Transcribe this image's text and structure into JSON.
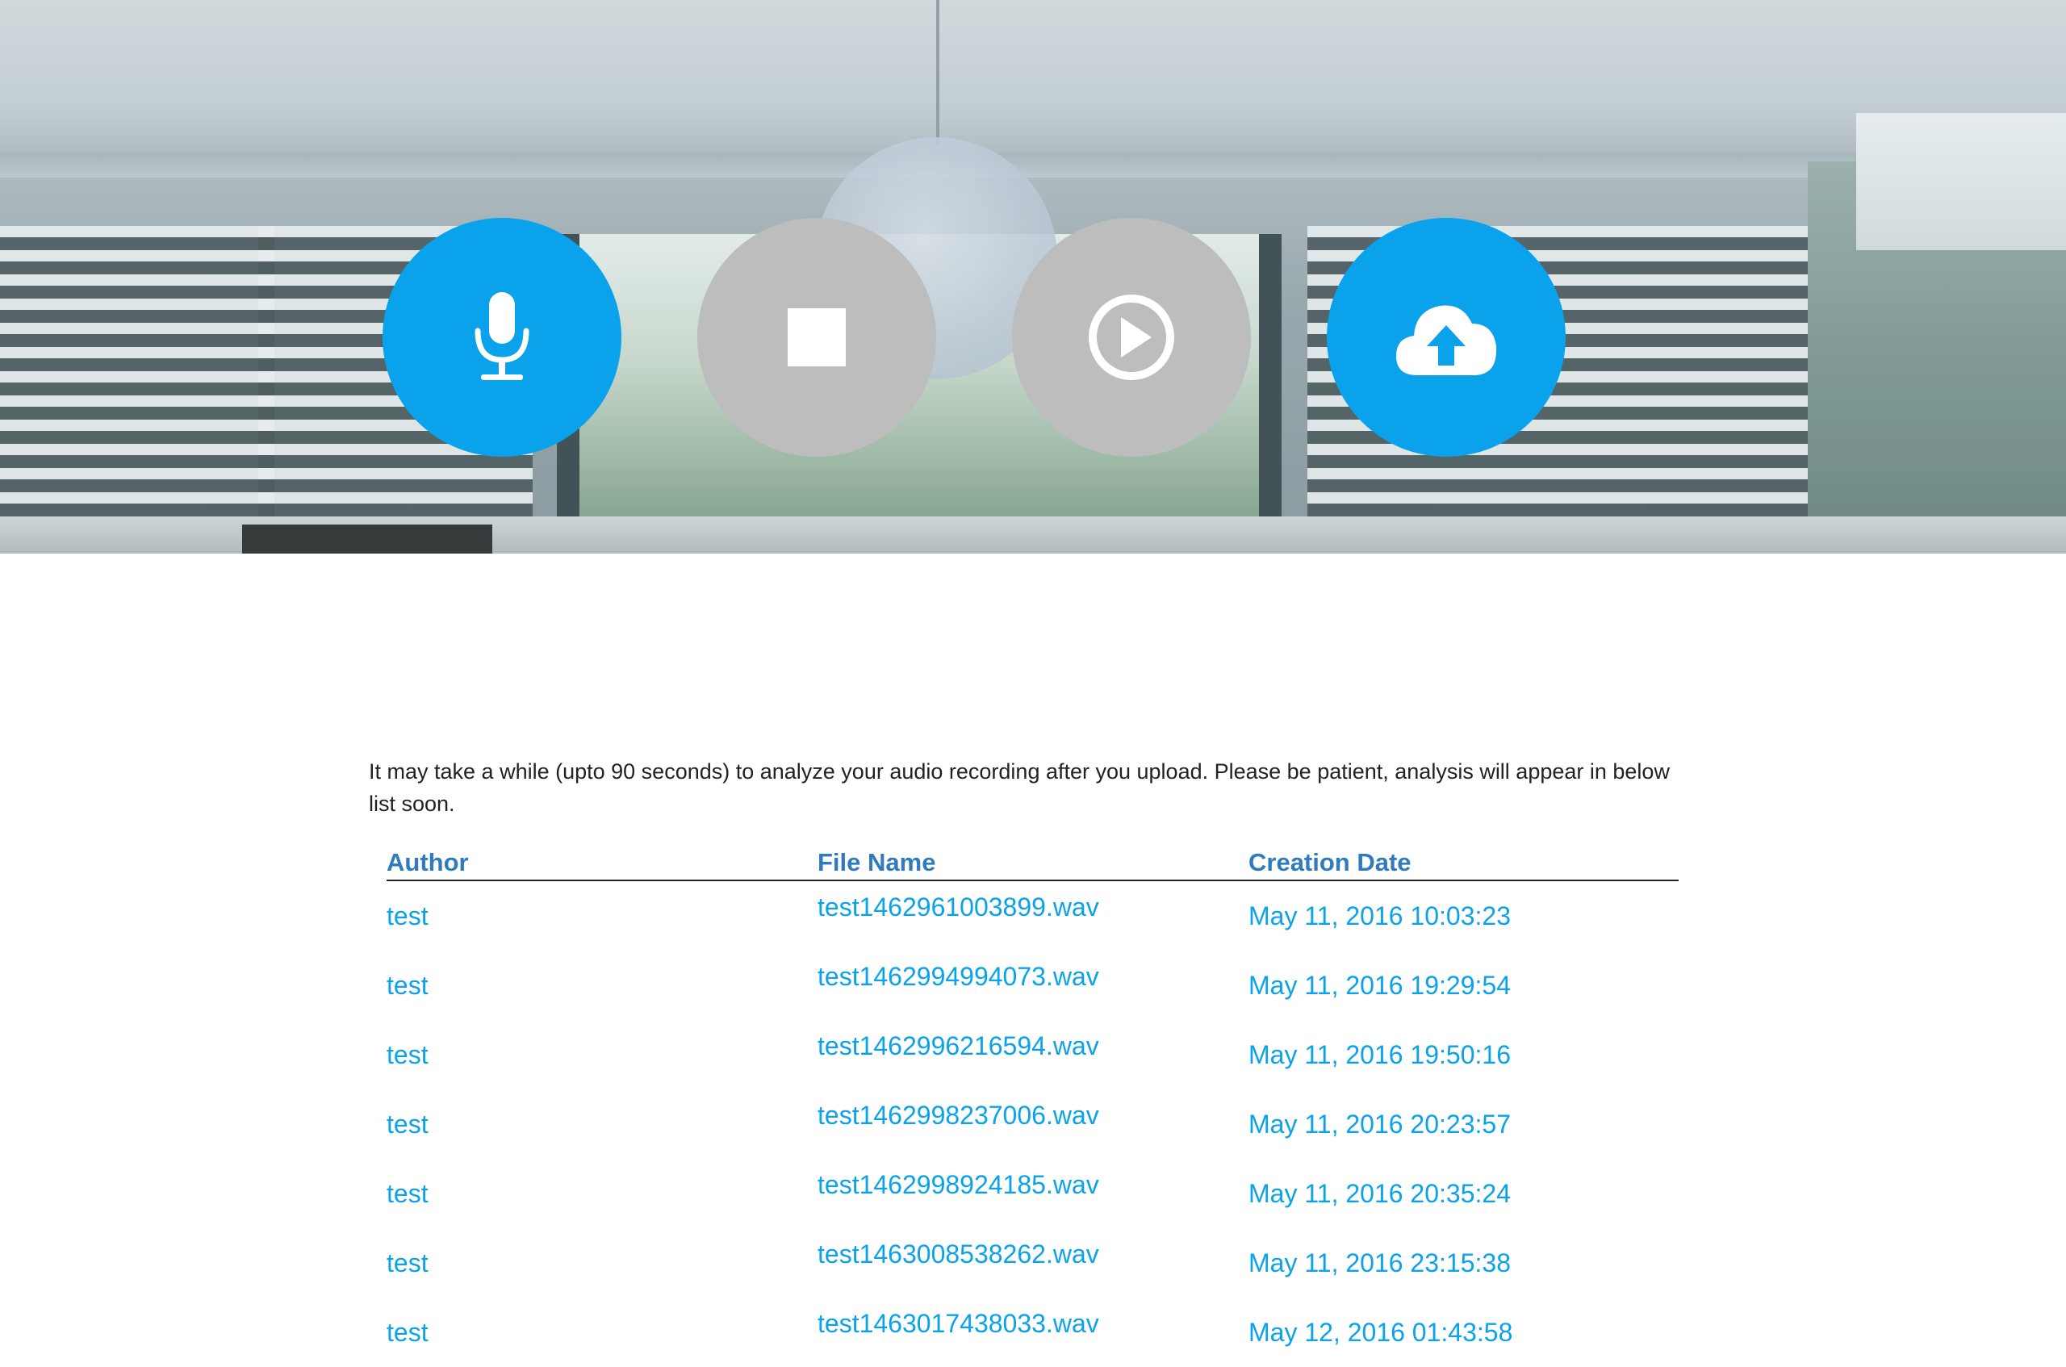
{
  "controls": {
    "record": {
      "icon": "microphone-icon",
      "state": "active",
      "color": "#0aa2ea"
    },
    "stop": {
      "icon": "stop-icon",
      "state": "disabled",
      "color": "#bdbdbd"
    },
    "play": {
      "icon": "play-circle-icon",
      "state": "disabled",
      "color": "#bdbdbd"
    },
    "upload": {
      "icon": "cloud-upload-icon",
      "state": "active",
      "color": "#0aa2ea"
    }
  },
  "notice": "It may take a while (upto 90 seconds) to analyze your audio recording after you upload. Please be patient, analysis will appear in below list soon.",
  "table": {
    "headers": {
      "author": "Author",
      "file_name": "File Name",
      "creation_date": "Creation Date"
    },
    "rows": [
      {
        "author": "test",
        "file_name": "test1462961003899.wav",
        "creation_date": "May 11, 2016 10:03:23"
      },
      {
        "author": "test",
        "file_name": "test1462994994073.wav",
        "creation_date": "May 11, 2016 19:29:54"
      },
      {
        "author": "test",
        "file_name": "test1462996216594.wav",
        "creation_date": "May 11, 2016 19:50:16"
      },
      {
        "author": "test",
        "file_name": "test1462998237006.wav",
        "creation_date": "May 11, 2016 20:23:57"
      },
      {
        "author": "test",
        "file_name": "test1462998924185.wav",
        "creation_date": "May 11, 2016 20:35:24"
      },
      {
        "author": "test",
        "file_name": "test1463008538262.wav",
        "creation_date": "May 11, 2016 23:15:38"
      },
      {
        "author": "test",
        "file_name": "test1463017438033.wav",
        "creation_date": "May 12, 2016 01:43:58"
      }
    ]
  },
  "colors": {
    "accent": "#0aa2ea",
    "disabled": "#bdbdbd",
    "header_text": "#2f7bbd",
    "body_text": "#222222"
  }
}
